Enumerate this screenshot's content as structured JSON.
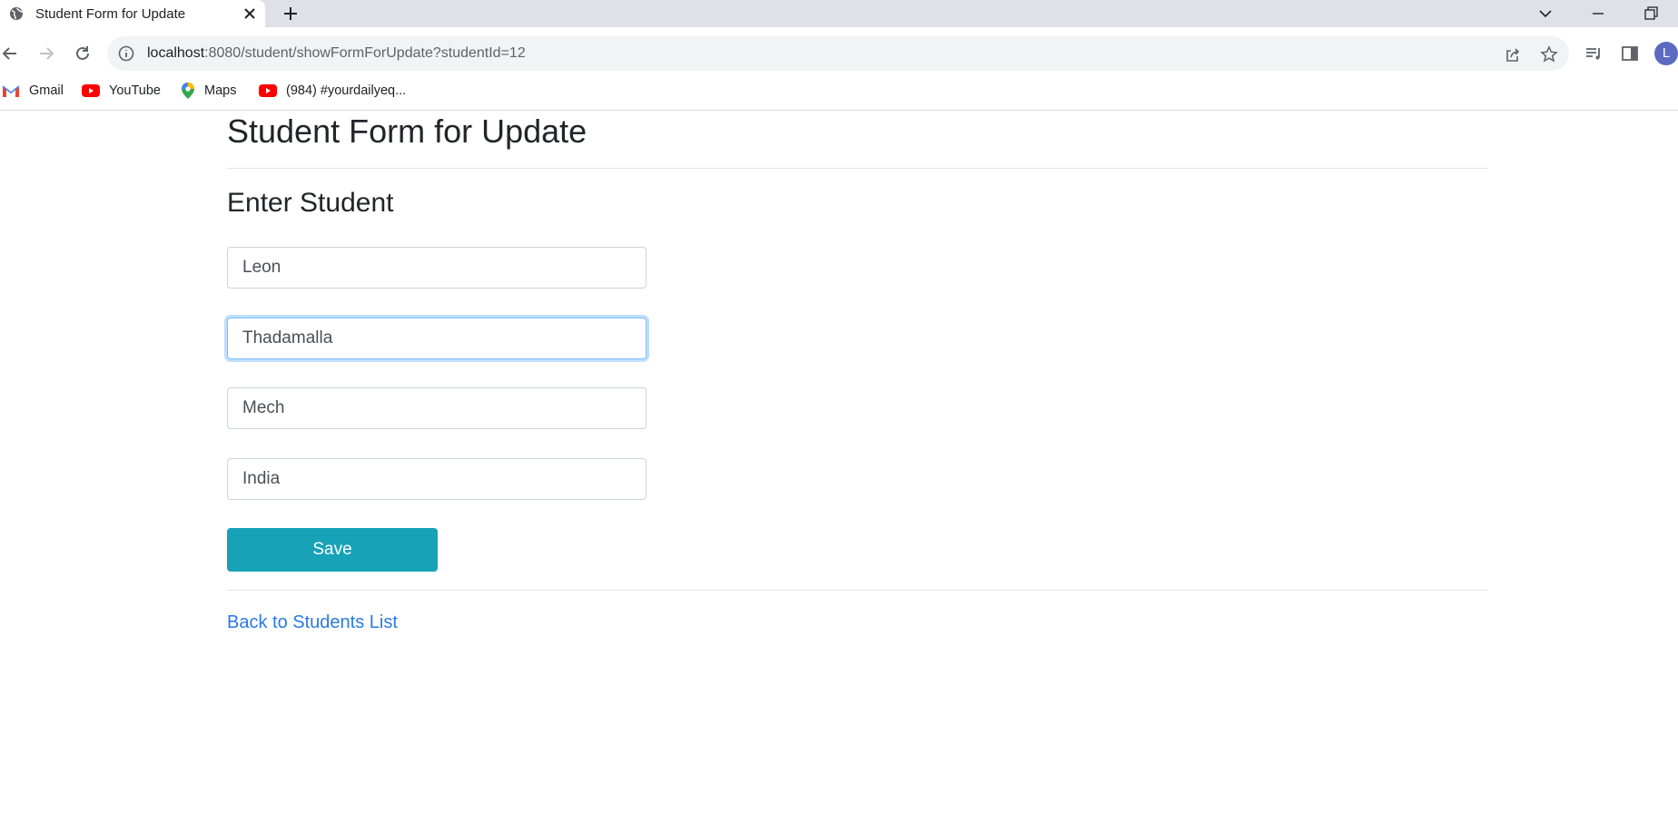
{
  "browser": {
    "tab": {
      "title": "Student Form for Update"
    },
    "address_bar": {
      "host": "localhost",
      "path": ":8080/student/showFormForUpdate?studentId=12"
    },
    "bookmarks": [
      {
        "label": "Gmail",
        "icon": "gmail-icon"
      },
      {
        "label": "YouTube",
        "icon": "youtube-icon"
      },
      {
        "label": "Maps",
        "icon": "maps-icon"
      },
      {
        "label": "(984) #yourdailyeq...",
        "icon": "youtube-icon"
      }
    ],
    "profile_initial": "L"
  },
  "page": {
    "title": "Student Form for Update",
    "section_title": "Enter Student",
    "form": {
      "first_name": "Leon",
      "last_name": "Thadamalla",
      "department": "Mech",
      "country": "India",
      "save_label": "Save"
    },
    "back_link": "Back to Students List"
  },
  "colors": {
    "save_button": "#17a2b8",
    "link": "#2a7ae2",
    "focus_ring": "#80bdff"
  }
}
